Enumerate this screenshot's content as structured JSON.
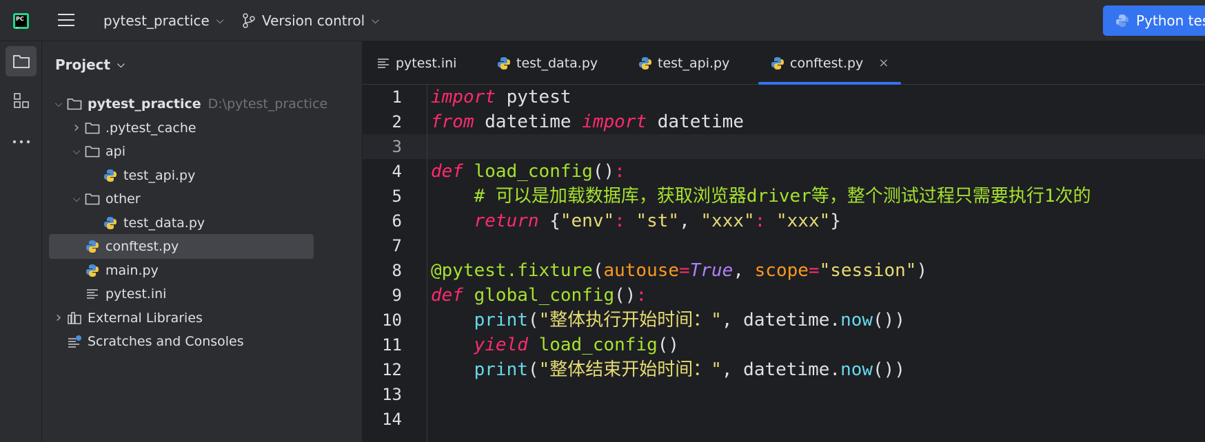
{
  "titlebar": {
    "project_name": "pytest_practice",
    "vcs_label": "Version control",
    "run_config": "Python tes"
  },
  "panel": {
    "title": "Project",
    "tree": [
      {
        "label": "pytest_practice",
        "path": "D:\\pytest_practice",
        "icon": "folder-icon",
        "arrow": "expanded",
        "indent": 0,
        "bold": true
      },
      {
        "label": ".pytest_cache",
        "icon": "folder-icon",
        "arrow": "collapsed",
        "indent": 1
      },
      {
        "label": "api",
        "icon": "folder-icon",
        "arrow": "expanded",
        "indent": 1
      },
      {
        "label": "test_api.py",
        "icon": "python-file-icon",
        "arrow": "none",
        "indent": 2
      },
      {
        "label": "other",
        "icon": "folder-icon",
        "arrow": "expanded",
        "indent": 1
      },
      {
        "label": "test_data.py",
        "icon": "python-file-icon",
        "arrow": "none",
        "indent": 2
      },
      {
        "label": "conftest.py",
        "icon": "python-file-icon",
        "arrow": "none",
        "indent": 1,
        "selected": true
      },
      {
        "label": "main.py",
        "icon": "python-file-icon",
        "arrow": "none",
        "indent": 1
      },
      {
        "label": "pytest.ini",
        "icon": "text-file-icon",
        "arrow": "none",
        "indent": 1
      },
      {
        "label": "External Libraries",
        "icon": "library-icon",
        "arrow": "collapsed",
        "indent": 0
      },
      {
        "label": "Scratches and Consoles",
        "icon": "scratches-icon",
        "arrow": "none",
        "indent": 0
      }
    ]
  },
  "tabs": [
    {
      "label": "pytest.ini",
      "icon": "text-file-icon"
    },
    {
      "label": "test_data.py",
      "icon": "python-file-icon"
    },
    {
      "label": "test_api.py",
      "icon": "python-file-icon"
    },
    {
      "label": "conftest.py",
      "icon": "python-file-icon",
      "active": true,
      "close": "×"
    }
  ],
  "editor": {
    "line_numbers": [
      "1",
      "2",
      "3",
      "4",
      "5",
      "6",
      "7",
      "8",
      "9",
      "10",
      "11",
      "12",
      "13",
      "14"
    ],
    "current_line": 3,
    "lines": [
      [
        [
          "kw",
          "import"
        ],
        [
          "p",
          " pytest"
        ]
      ],
      [
        [
          "kw",
          "from"
        ],
        [
          "p",
          " datetime "
        ],
        [
          "kw",
          "import"
        ],
        [
          "p",
          " datetime"
        ]
      ],
      [],
      [
        [
          "kw",
          "def"
        ],
        [
          "p",
          " "
        ],
        [
          "fn",
          "load_config"
        ],
        [
          "p",
          "()"
        ],
        [
          "pu",
          ":"
        ]
      ],
      [
        [
          "p",
          "    "
        ],
        [
          "cm",
          "# 可以是加载数据库，获取浏览器driver等，整个测试过程只需要执行1次的"
        ]
      ],
      [
        [
          "p",
          "    "
        ],
        [
          "kw",
          "return"
        ],
        [
          "p",
          " {"
        ],
        [
          "st",
          "\"env\""
        ],
        [
          "pu",
          ":"
        ],
        [
          "p",
          " "
        ],
        [
          "st",
          "\"st\""
        ],
        [
          "p",
          ", "
        ],
        [
          "st",
          "\"xxx\""
        ],
        [
          "pu",
          ":"
        ],
        [
          "p",
          " "
        ],
        [
          "st",
          "\"xxx\""
        ],
        [
          "p",
          "}"
        ]
      ],
      [],
      [
        [
          "dec",
          "@pytest.fixture"
        ],
        [
          "p",
          "("
        ],
        [
          "pa",
          "autouse"
        ],
        [
          "pu",
          "="
        ],
        [
          "tr",
          "True"
        ],
        [
          "p",
          ", "
        ],
        [
          "pa",
          "scope"
        ],
        [
          "pu",
          "="
        ],
        [
          "st",
          "\"session\""
        ],
        [
          "p",
          ")"
        ]
      ],
      [
        [
          "kw",
          "def"
        ],
        [
          "p",
          " "
        ],
        [
          "fn",
          "global_config"
        ],
        [
          "p",
          "()"
        ],
        [
          "pu",
          ":"
        ]
      ],
      [
        [
          "p",
          "    "
        ],
        [
          "bi",
          "print"
        ],
        [
          "p",
          "("
        ],
        [
          "st",
          "\"整体执行开始时间：\""
        ],
        [
          "p",
          ", datetime."
        ],
        [
          "bi",
          "now"
        ],
        [
          "p",
          "())"
        ]
      ],
      [
        [
          "p",
          "    "
        ],
        [
          "kw",
          "yield"
        ],
        [
          "p",
          " "
        ],
        [
          "fn",
          "load_config"
        ],
        [
          "p",
          "()"
        ]
      ],
      [
        [
          "p",
          "    "
        ],
        [
          "bi",
          "print"
        ],
        [
          "p",
          "("
        ],
        [
          "st",
          "\"整体结束开始时间：\""
        ],
        [
          "p",
          ", datetime."
        ],
        [
          "bi",
          "now"
        ],
        [
          "p",
          "())"
        ]
      ],
      [],
      []
    ]
  },
  "colors": {
    "accent": "#3574f0",
    "keyword": "#ff2a6e",
    "function": "#a6e22e",
    "string": "#e6db74",
    "builtin": "#66d9ef",
    "param": "#fd971f"
  }
}
